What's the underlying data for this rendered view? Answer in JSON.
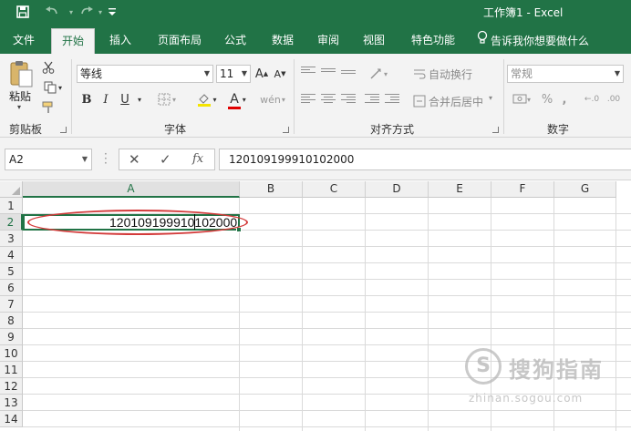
{
  "titlebar": {
    "title": "工作簿1  -  Excel",
    "icons": [
      "save-icon",
      "undo-icon",
      "redo-icon",
      "customize-icon"
    ]
  },
  "tabs": [
    {
      "label": "文件",
      "active": false
    },
    {
      "label": "开始",
      "active": true
    },
    {
      "label": "插入",
      "active": false
    },
    {
      "label": "页面布局",
      "active": false
    },
    {
      "label": "公式",
      "active": false
    },
    {
      "label": "数据",
      "active": false
    },
    {
      "label": "审阅",
      "active": false
    },
    {
      "label": "视图",
      "active": false
    },
    {
      "label": "特色功能",
      "active": false
    }
  ],
  "tellme": {
    "label": "告诉我你想要做什么",
    "icon": "lightbulb-icon"
  },
  "ribbon": {
    "clipboard": {
      "group_label": "剪贴板",
      "paste_label": "粘贴"
    },
    "font": {
      "group_label": "字体",
      "font_name": "等线",
      "font_size": "11",
      "bold": "B",
      "italic": "I",
      "underline": "U",
      "font_color_glyph": "A",
      "grow": "A",
      "shrink": "A"
    },
    "alignment": {
      "group_label": "对齐方式",
      "wrap_text": "自动换行",
      "merge_center": "合并后居中"
    },
    "number": {
      "group_label": "数字",
      "format": "常规",
      "percent": "%",
      "comma": ","
    }
  },
  "formula_bar": {
    "name_box": "A2",
    "cancel": "✕",
    "enter": "✓",
    "fx": "fx",
    "value": "120109199910102000"
  },
  "grid": {
    "columns": [
      "A",
      "B",
      "C",
      "D",
      "E",
      "F",
      "G"
    ],
    "rows": [
      "1",
      "2",
      "3",
      "4",
      "5",
      "6",
      "7",
      "8",
      "9",
      "10",
      "11",
      "12",
      "13",
      "14"
    ],
    "active_cell": "A2",
    "active_value": "120109199910102000"
  },
  "accent_color": "#217346",
  "highlight_color": "#d33b3b",
  "watermark": {
    "text": "搜狗指南",
    "url": "zhinan.sogou.com"
  }
}
